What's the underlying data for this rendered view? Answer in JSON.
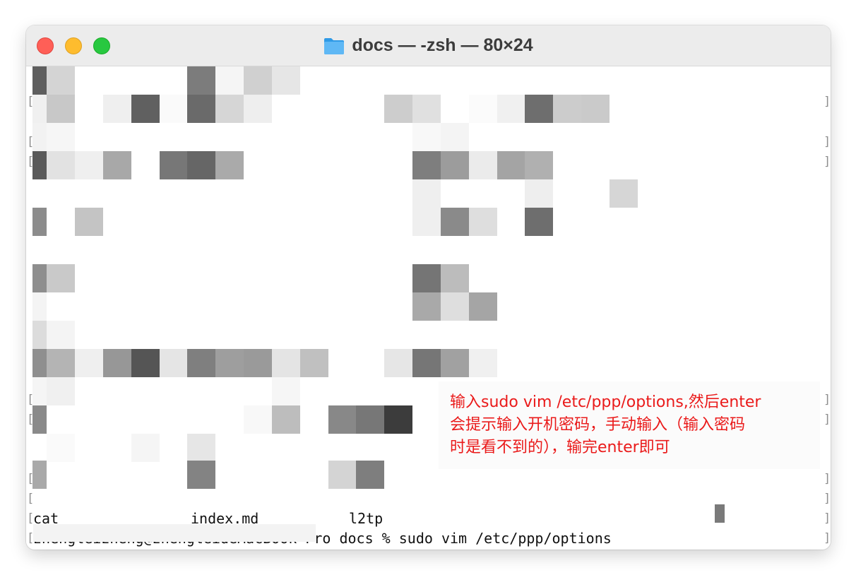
{
  "window": {
    "title": "docs — -zsh — 80×24",
    "traffic_lights": [
      "close",
      "minimize",
      "zoom"
    ],
    "folder_icon": "folder-icon"
  },
  "terminal": {
    "files": [
      "cat",
      "index.md",
      "l2tp"
    ],
    "prompt": "zhengleizheng@zhengleideMacBook-Pro docs % sudo vim /etc/ppp/options",
    "bracket_left": "[",
    "bracket_right": "]"
  },
  "annotation": {
    "lines": [
      "输入sudo vim /etc/ppp/options,然后enter",
      "会提示输入开机密码，手动输入（输入密码",
      "时是看不到的），输完enter即可"
    ],
    "color": "#ea1a1a"
  },
  "colors": {
    "titlebar": "#ececec",
    "red_light": "#ff5f57",
    "yellow_light": "#febc2e",
    "green_light": "#28c840"
  }
}
